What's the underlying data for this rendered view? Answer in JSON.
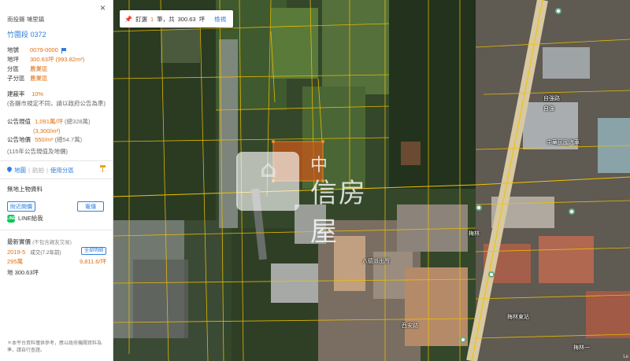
{
  "panel": {
    "location": "南投縣 埔里鎮",
    "parcel": "竹圍段 0372",
    "fields": [
      {
        "key": "地號",
        "value": "0079-0000"
      },
      {
        "key": "地坪",
        "value": "300.63坪 (993.82m²)"
      },
      {
        "key": "分區",
        "value": "農業區"
      },
      {
        "key": "子分區",
        "value": "農業區"
      }
    ],
    "coverage_key": "建蔽率",
    "coverage_value": "10%",
    "coverage_note": "(各縣市規定不同，請以政府公告為準)",
    "land_value_key": "公告現值",
    "land_value_main": "1,091萬/坪",
    "land_value_total": "(總328萬)",
    "land_value_sqm": "(3,300/m²)",
    "land_price_key": "公告地價",
    "land_price_main": "550/m²",
    "land_price_total": "(總54.7萬)",
    "year_note": "(115年公告現值及地價)",
    "link_map": "地圖",
    "link_aerial": "航拍",
    "link_zoning": "使用分區",
    "no_building": "無地上物資料",
    "btn_nearby": "附近開價",
    "btn_phone": "電傳",
    "line_share": "LINE給我",
    "line_icon_text": "LINE",
    "trades_title": "最新實價",
    "trades_sub": "(不包含親友交易)",
    "trade_date": "2019-5",
    "trade_status": "成交(7.2年前)",
    "trade_all": "全部明細",
    "trade_price": "295萬",
    "trade_unit": "9,811.6/坪",
    "trade_area": "地 300.63坪",
    "footnote": "＊本平台資料僅供參考，應以政府機關資料為準，請自行查證。",
    "close_label": "×"
  },
  "summary": {
    "label_pre": "釘選",
    "count": "1",
    "label_mid": "筆，共",
    "area": "300.63",
    "unit": "坪",
    "view": "檢視"
  },
  "watermark": {
    "brand_char": "中",
    "brand_text": "信房屋"
  },
  "map_labels": [
    "梅林",
    "西安路",
    "梅林一",
    "梅林東站",
    "自強路",
    "自強",
    "中華民國汽車",
    "八德派出所"
  ],
  "credit": "Le",
  "colors": {
    "accent_orange": "#e07010",
    "link_blue": "#2f7fd8",
    "parcel_line": "#f2c200",
    "highlight": "#c8581a"
  }
}
